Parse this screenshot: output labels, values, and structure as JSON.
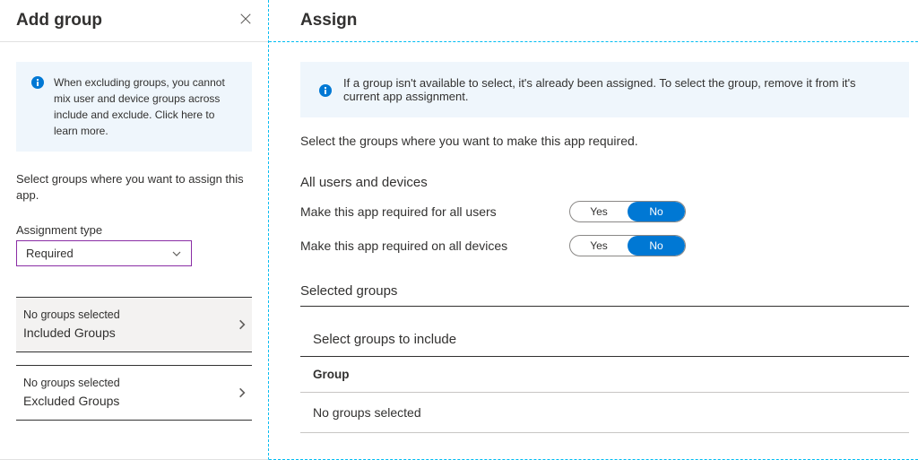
{
  "left": {
    "title": "Add group",
    "infoBanner": "When excluding groups, you cannot mix user and device groups across include and exclude.  Click here to learn more.",
    "selectText": "Select groups where you want to assign this app.",
    "assignmentTypeLabel": "Assignment type",
    "assignmentTypeValue": "Required",
    "included": {
      "status": "No groups selected",
      "label": "Included Groups"
    },
    "excluded": {
      "status": "No groups selected",
      "label": "Excluded Groups"
    }
  },
  "right": {
    "title": "Assign",
    "infoBanner": "If a group isn't available to select, it's already been assigned. To select the group, remove it from it's current app assignment.",
    "instruction": "Select the groups where you want to make this app required.",
    "allHeading": "All users and devices",
    "toggles": {
      "allUsers": {
        "label": "Make this app required for all users",
        "yes": "Yes",
        "no": "No",
        "value": "No"
      },
      "allDevices": {
        "label": "Make this app required on all devices",
        "yes": "Yes",
        "no": "No",
        "value": "No"
      }
    },
    "selectedGroupsHeading": "Selected groups",
    "selectInclude": "Select groups to include",
    "groupColumn": "Group",
    "emptyText": "No groups selected"
  }
}
